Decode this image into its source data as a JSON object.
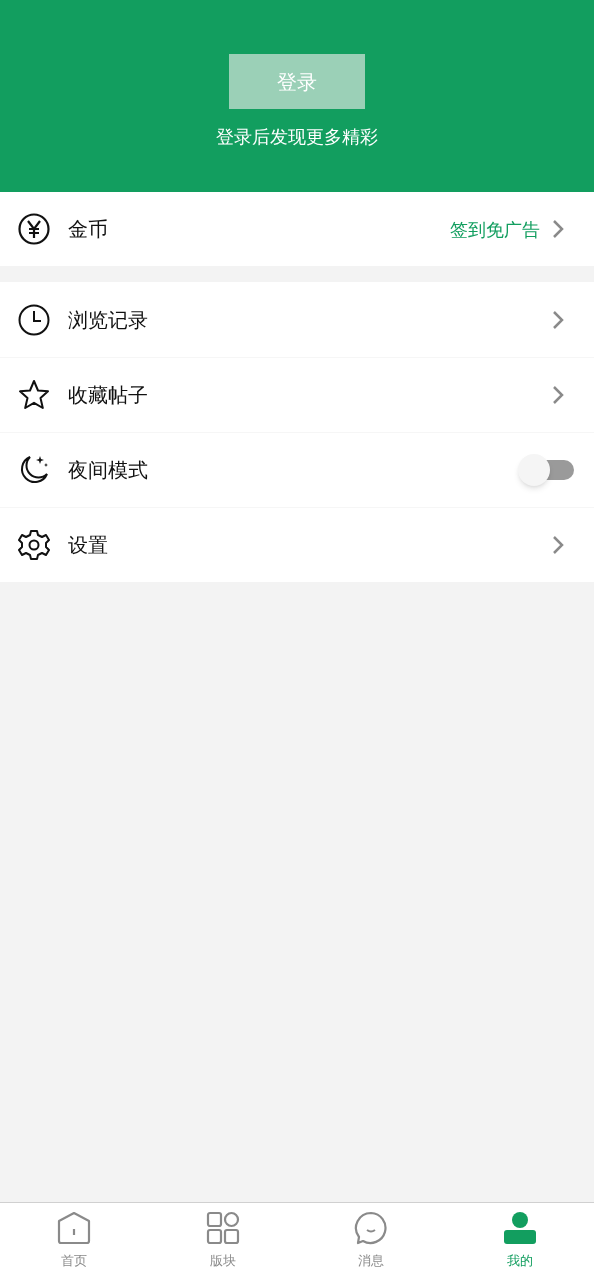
{
  "header": {
    "login_button": "登录",
    "subtitle": "登录后发现更多精彩"
  },
  "coin_row": {
    "label": "金币",
    "action": "签到免广告"
  },
  "menu": [
    {
      "kind": "link",
      "label": "浏览记录"
    },
    {
      "kind": "link",
      "label": "收藏帖子"
    },
    {
      "kind": "toggle",
      "label": "夜间模式",
      "on": false
    },
    {
      "kind": "link",
      "label": "设置"
    }
  ],
  "tabs": [
    {
      "label": "首页",
      "selected": false
    },
    {
      "label": "版块",
      "selected": false
    },
    {
      "label": "消息",
      "selected": false
    },
    {
      "label": "我的",
      "selected": true
    }
  ]
}
